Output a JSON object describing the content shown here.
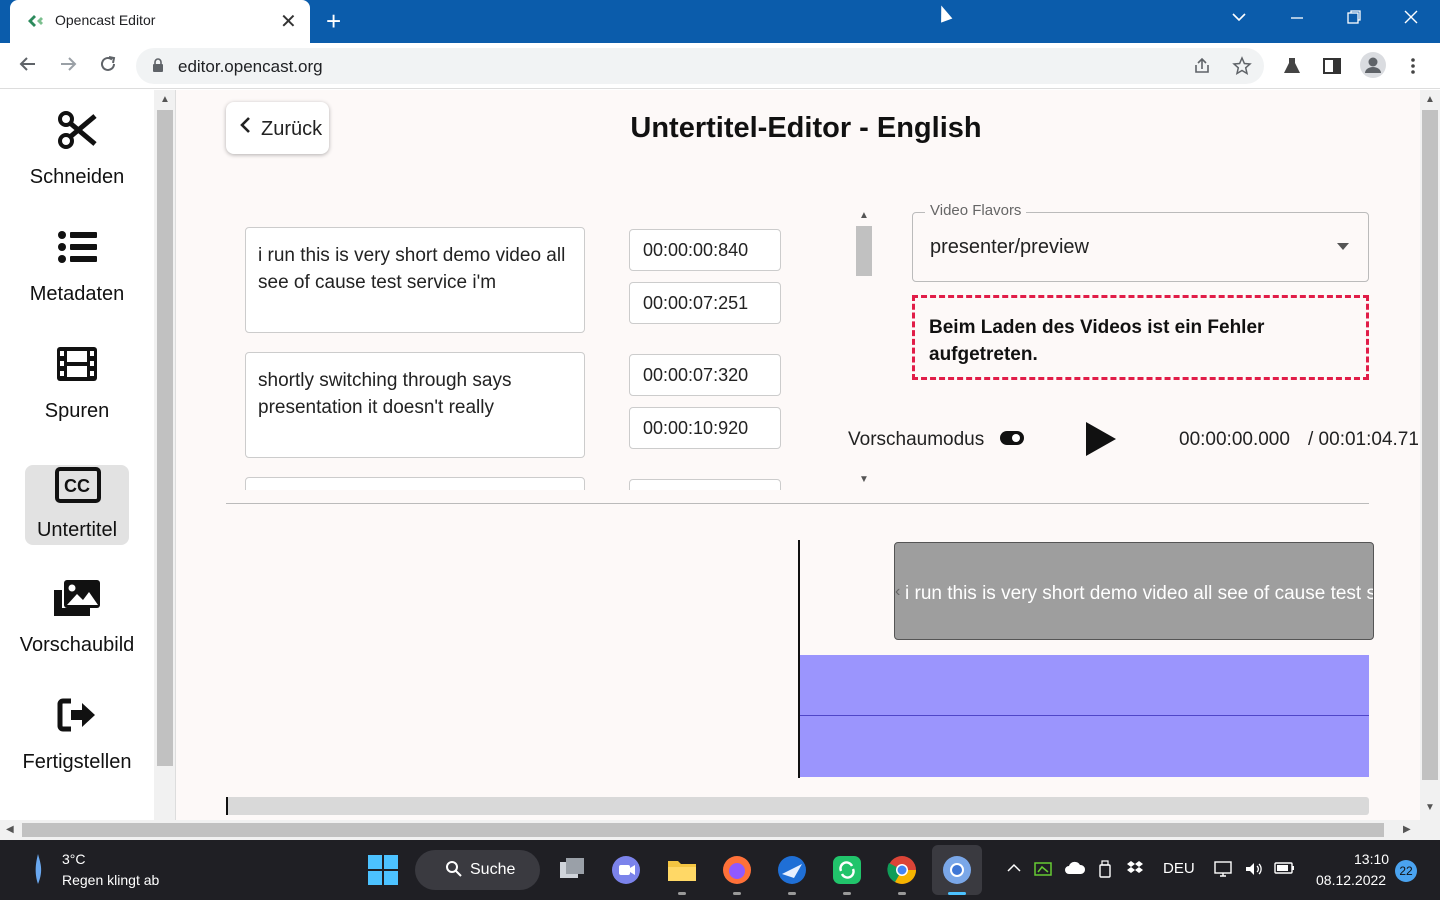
{
  "browser": {
    "tab_title": "Opencast Editor",
    "tab_close": "✕",
    "new_tab": "+",
    "url": "editor.opencast.org"
  },
  "sidebar": {
    "items": [
      {
        "label": "Schneiden",
        "icon": "scissors-icon",
        "active": false
      },
      {
        "label": "Metadaten",
        "icon": "list-icon",
        "active": false
      },
      {
        "label": "Spuren",
        "icon": "film-icon",
        "active": false
      },
      {
        "label": "Untertitel",
        "icon": "closed-captions-icon",
        "active": true
      },
      {
        "label": "Vorschaubild",
        "icon": "images-icon",
        "active": false
      },
      {
        "label": "Fertigstellen",
        "icon": "sign-out-icon",
        "active": false
      }
    ]
  },
  "main": {
    "back_label": "Zurück",
    "title": "Untertitel-Editor - English",
    "subtitles": [
      {
        "text": "i run this is very short demo video all see of cause test service i'm",
        "start": "00:00:00:840",
        "end": "00:00:07:251"
      },
      {
        "text": "shortly switching through says presentation it doesn't really",
        "start": "00:00:07:320",
        "end": "00:00:10:920"
      }
    ],
    "video_flavors": {
      "legend": "Video Flavors",
      "value": "presenter/preview"
    },
    "error": "Beim Laden des Videos ist ein Fehler aufgetreten.",
    "preview_mode_label": "Vorschaumodus",
    "current_time": "00:00:00.000",
    "total_time": "/ 00:01:04.71",
    "timeline_segment_text": "i run this is very short demo video all see of cause test service i'm",
    "playhead_fraction": 0
  },
  "taskbar": {
    "temperature": "3°C",
    "weather": "Regen klingt ab",
    "search_label": "Suche",
    "language": "DEU",
    "time": "13:10",
    "date": "08.12.2022",
    "notifications": "22"
  }
}
